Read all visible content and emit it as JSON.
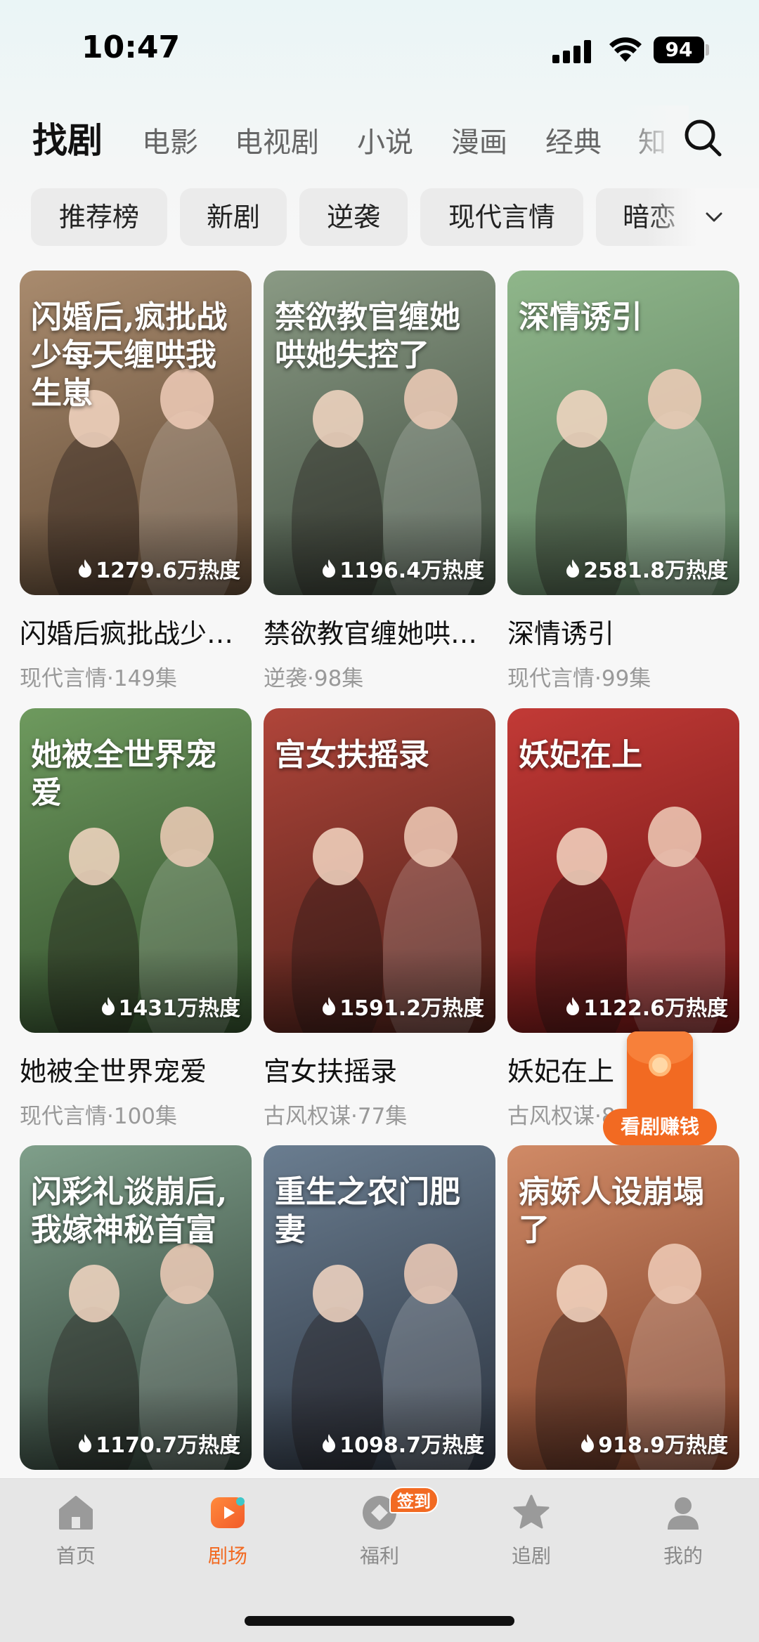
{
  "status_bar": {
    "time": "10:47",
    "battery": "94"
  },
  "nav": {
    "tabs": [
      {
        "label": "找剧",
        "active": true
      },
      {
        "label": "电影"
      },
      {
        "label": "电视剧"
      },
      {
        "label": "小说"
      },
      {
        "label": "漫画"
      },
      {
        "label": "经典"
      },
      {
        "label": "知"
      }
    ],
    "search_icon": "search-icon"
  },
  "chips": [
    "推荐榜",
    "新剧",
    "逆袭",
    "现代言情",
    "暗恋"
  ],
  "cards": [
    {
      "poster_text": "闪婚后,疯批战少每天缠哄我生崽",
      "heat": "1279.6万热度",
      "title": "闪婚后疯批战少每天缠哄我生崽",
      "meta": "现代言情·149集",
      "colors": [
        "#a98b6e",
        "#5c4632"
      ]
    },
    {
      "poster_text": "禁欲教官缠她哄她失控了",
      "heat": "1196.4万热度",
      "title": "禁欲教官缠她哄她失控了",
      "meta": "逆袭·98集",
      "colors": [
        "#8a9a84",
        "#3f4c3f"
      ]
    },
    {
      "poster_text": "深情诱引",
      "heat": "2581.8万热度",
      "title": "深情诱引",
      "meta": "现代言情·99集",
      "colors": [
        "#8fb68a",
        "#5d7e60"
      ]
    },
    {
      "poster_text": "她被全世界宠爱",
      "heat": "1431万热度",
      "title": "她被全世界宠爱",
      "meta": "现代言情·100集",
      "colors": [
        "#6e9a5e",
        "#2f4a2a"
      ]
    },
    {
      "poster_text": "宫女扶摇录",
      "heat": "1591.2万热度",
      "title": "宫女扶摇录",
      "meta": "古风权谋·77集",
      "colors": [
        "#b0453a",
        "#4a1f18"
      ]
    },
    {
      "poster_text": "妖妃在上",
      "heat": "1122.6万热度",
      "title": "妖妃在上",
      "meta": "古风权谋·8",
      "colors": [
        "#c23a36",
        "#6a1414"
      ]
    },
    {
      "poster_text": "闪彩礼谈崩后,我嫁神秘首富",
      "heat": "1170.7万热度",
      "title": "",
      "meta": "",
      "colors": [
        "#7f9f8a",
        "#2d3c34"
      ]
    },
    {
      "poster_text": "重生之农门肥妻",
      "heat": "1098.7万热度",
      "title": "",
      "meta": "",
      "colors": [
        "#6a7d90",
        "#2c3440"
      ]
    },
    {
      "poster_text": "病娇人设崩塌了",
      "heat": "918.9万热度",
      "title": "",
      "meta": "",
      "colors": [
        "#d08a66",
        "#7a3c26"
      ]
    }
  ],
  "promo": {
    "label": "看剧赚钱"
  },
  "tabbar": {
    "items": [
      {
        "label": "首页",
        "icon": "home-icon"
      },
      {
        "label": "剧场",
        "icon": "theater-icon",
        "active": true
      },
      {
        "label": "福利",
        "icon": "gift-icon"
      },
      {
        "label": "追剧",
        "icon": "star-icon"
      },
      {
        "label": "我的",
        "icon": "person-icon"
      }
    ],
    "badge": "签到"
  },
  "colors": {
    "accent": "#f26a22",
    "active_tab": "#111111",
    "muted": "#999999"
  }
}
